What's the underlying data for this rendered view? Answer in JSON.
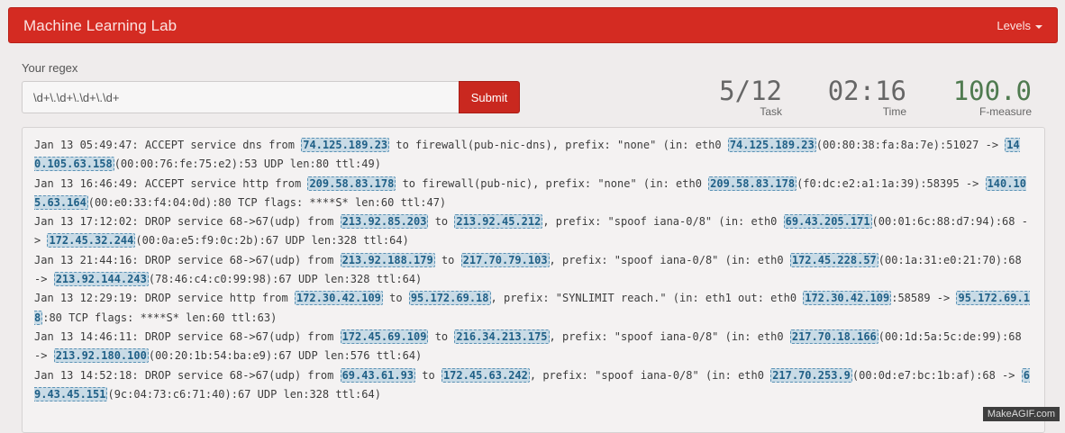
{
  "navbar": {
    "brand": "Machine Learning Lab",
    "levels_label": "Levels"
  },
  "regex": {
    "label": "Your regex",
    "value": "\\d+\\.\\d+\\.\\d+\\.\\d+",
    "submit_label": "Submit"
  },
  "stats": {
    "task": {
      "value": "5/12",
      "label": "Task"
    },
    "time": {
      "value": "02:16",
      "label": "Time"
    },
    "fmeasure": {
      "value": "100.0",
      "label": "F-measure"
    }
  },
  "log_lines": [
    [
      {
        "t": "Jan 13 05:49:47: ACCEPT service dns from "
      },
      {
        "h": "74.125.189.23"
      },
      {
        "t": " to firewall(pub-nic-dns), prefix: \"none\" (in: eth0 "
      },
      {
        "h": "74.125.189.23"
      },
      {
        "t": "(00:80:38:fa:8a:7e):51027 -> "
      },
      {
        "h": "140.105.63.158"
      },
      {
        "t": "(00:00:76:fe:75:e2):53 UDP len:80 ttl:49)"
      }
    ],
    [
      {
        "t": "Jan 13 16:46:49: ACCEPT service http from "
      },
      {
        "h": "209.58.83.178"
      },
      {
        "t": " to firewall(pub-nic), prefix: \"none\" (in: eth0 "
      },
      {
        "h": "209.58.83.178"
      },
      {
        "t": "(f0:dc:e2:a1:1a:39):58395 -> "
      },
      {
        "h": "140.105.63.164"
      },
      {
        "t": "(00:e0:33:f4:04:0d):80 TCP flags: ****S* len:60 ttl:47)"
      }
    ],
    [
      {
        "t": "Jan 13 17:12:02: DROP service 68->67(udp) from "
      },
      {
        "h": "213.92.85.203"
      },
      {
        "t": " to "
      },
      {
        "h": "213.92.45.212"
      },
      {
        "t": ", prefix: \"spoof iana-0/8\" (in: eth0 "
      },
      {
        "h": "69.43.205.171"
      },
      {
        "t": "(00:01:6c:88:d7:94):68 -> "
      },
      {
        "h": "172.45.32.244"
      },
      {
        "t": "(00:0a:e5:f9:0c:2b):67 UDP len:328 ttl:64)"
      }
    ],
    [
      {
        "t": "Jan 13 21:44:16: DROP service 68->67(udp) from "
      },
      {
        "h": "213.92.188.179"
      },
      {
        "t": " to "
      },
      {
        "h": "217.70.79.103"
      },
      {
        "t": ", prefix: \"spoof iana-0/8\" (in: eth0 "
      },
      {
        "h": "172.45.228.57"
      },
      {
        "t": "(00:1a:31:e0:21:70):68 -> "
      },
      {
        "h": "213.92.144.243"
      },
      {
        "t": "(78:46:c4:c0:99:98):67 UDP len:328 ttl:64)"
      }
    ],
    [
      {
        "t": "Jan 13 12:29:19: DROP service http from "
      },
      {
        "h": "172.30.42.109"
      },
      {
        "t": " to "
      },
      {
        "h": "95.172.69.18"
      },
      {
        "t": ", prefix: \"SYNLIMIT reach.\" (in: eth1 out: eth0 "
      },
      {
        "h": "172.30.42.109"
      },
      {
        "t": ":58589 -> "
      },
      {
        "h": "95.172.69.18"
      },
      {
        "t": ":80 TCP flags: ****S* len:60 ttl:63)"
      }
    ],
    [
      {
        "t": "Jan 13 14:46:11: DROP service 68->67(udp) from "
      },
      {
        "h": "172.45.69.109"
      },
      {
        "t": " to "
      },
      {
        "h": "216.34.213.175"
      },
      {
        "t": ", prefix: \"spoof iana-0/8\" (in: eth0 "
      },
      {
        "h": "217.70.18.166"
      },
      {
        "t": "(00:1d:5a:5c:de:99):68 -> "
      },
      {
        "h": "213.92.180.100"
      },
      {
        "t": "(00:20:1b:54:ba:e9):67 UDP len:576 ttl:64)"
      }
    ],
    [
      {
        "t": "Jan 13 14:52:18: DROP service 68->67(udp) from "
      },
      {
        "h": "69.43.61.93"
      },
      {
        "t": " to "
      },
      {
        "h": "172.45.63.242"
      },
      {
        "t": ", prefix: \"spoof iana-0/8\" (in: eth0 "
      },
      {
        "h": "217.70.253.9"
      },
      {
        "t": "(00:0d:e7:bc:1b:af):68 -> "
      },
      {
        "h": "69.43.45.151"
      },
      {
        "t": "(9c:04:73:c6:71:40):67 UDP len:328 ttl:64)"
      }
    ]
  ],
  "watermark": "MakeAGIF.com",
  "colors": {
    "navbar": "#d42b22",
    "submit": "#c9281f",
    "match_bg": "#c9dbe6",
    "match_text": "#1f5f86",
    "fmeasure": "#4f7a4f"
  }
}
